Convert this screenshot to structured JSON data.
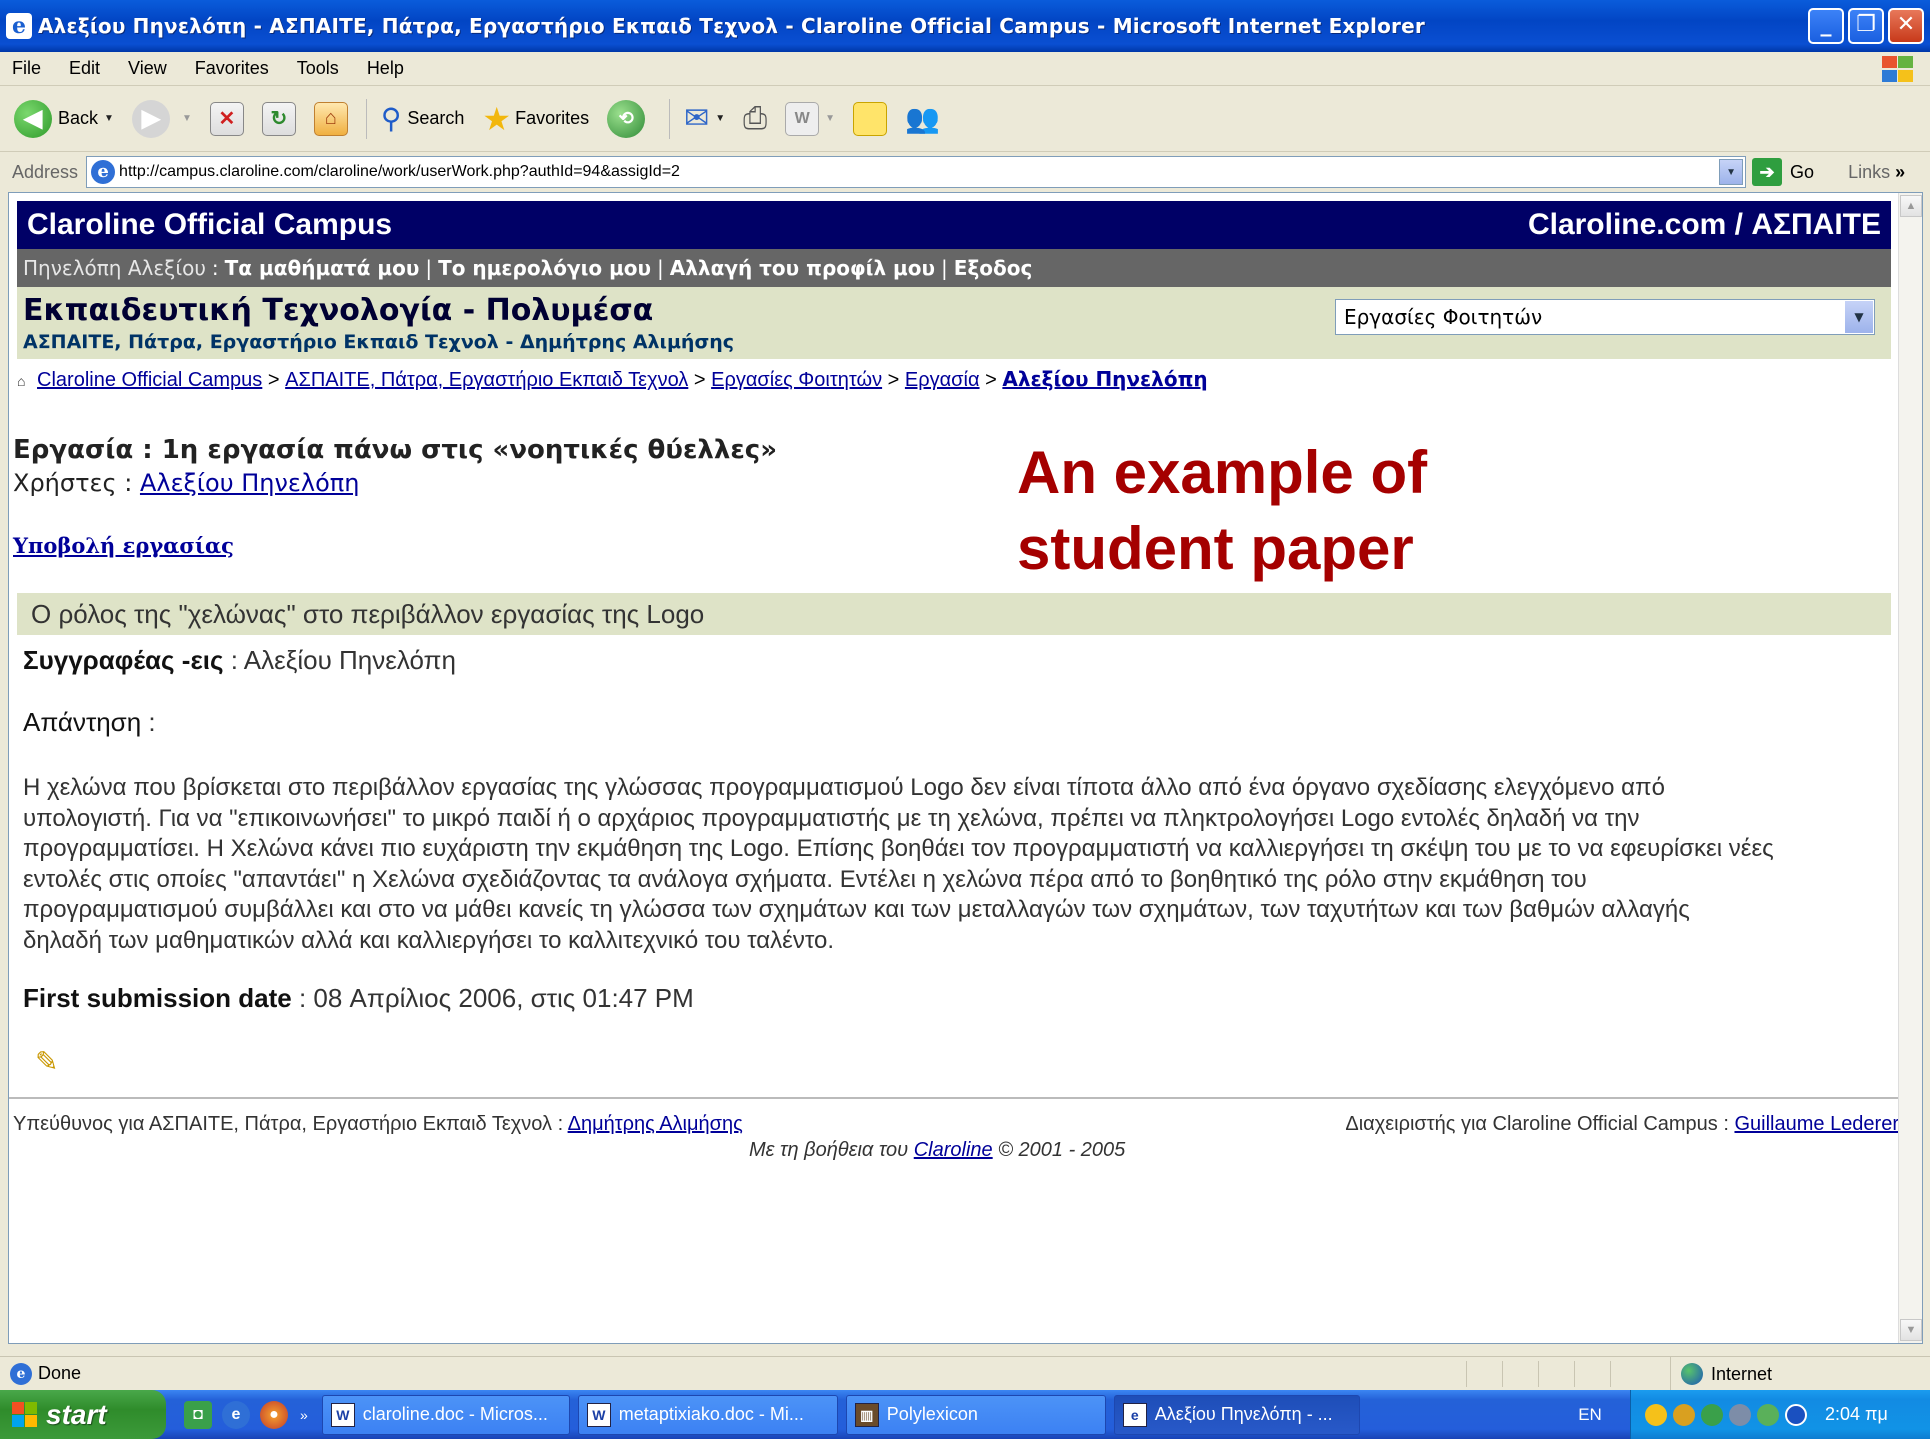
{
  "window": {
    "title": "Αλεξίου Πηνελόπη - ΑΣΠΑΙΤΕ, Πάτρα, Εργαστήριο Εκπαιδ Τεχνολ - Claroline Official Campus - Microsoft Internet Explorer",
    "buttons": {
      "minimize": "_",
      "maximize": "❐",
      "close": "✕"
    }
  },
  "menu": [
    "File",
    "Edit",
    "View",
    "Favorites",
    "Tools",
    "Help"
  ],
  "toolbar": {
    "back": "Back",
    "search": "Search",
    "favorites": "Favorites"
  },
  "address": {
    "label": "Address",
    "url": "http://campus.claroline.com/claroline/work/userWork.php?authId=94&assigId=2",
    "go": "Go",
    "links": "Links"
  },
  "page": {
    "campus_name": "Claroline Official Campus",
    "campus_right": "Claroline.com / ΑΣΠΑΙΤΕ",
    "user_name": "Πηνελόπη Αλεξίου",
    "user_links": [
      "Τα μαθήματά μου",
      "Το ημερολόγιο μου",
      "Αλλαγή του προφίλ μου",
      "Εξοδος"
    ],
    "course_title": "Εκπαιδευτική Τεχνολογία - Πολυμέσα",
    "course_subtitle": "ΑΣΠΑΙΤΕ, Πάτρα, Εργαστήριο Εκπαιδ Τεχνολ - Δημήτρης Αλιμήσης",
    "tool_select": "Εργασίες Φοιτητών",
    "breadcrumb": [
      "Claroline Official Campus",
      "ΑΣΠΑΙΤΕ, Πάτρα, Εργαστήριο Εκπαιδ Τεχνολ",
      "Εργασίες Φοιτητών",
      "Εργασία",
      "Αλεξίου Πηνελόπη"
    ],
    "assignment_label": "Εργασία",
    "assignment_title": "1η εργασία πάνω στις «νοητικές θύελλες»",
    "users_label": "Χρήστες",
    "users_value": "Αλεξίου Πηνελόπη",
    "submit_link": "Υποβολή εργασίας",
    "paper_title": "Ο ρόλος της \"χελώνας\" στο περιβάλλον εργασίας της Logo",
    "authors_label": "Συγγραφέας -εις",
    "authors_value": "Αλεξίου Πηνελόπη",
    "answer_label": "Απάντηση",
    "answer_lines": [
      "Η χελώνα που βρίσκεται στο περιβάλλον εργασίας της γλώσσας προγραμματισμού Logo δεν είναι τίποτα άλλο από ένα όργανο σχεδίασης ελεγχόμενο από",
      "υπολογιστή. Για να \"επικοινωνήσει\" το μικρό παιδί ή ο αρχάριος προγραμματιστής με τη χελώνα, πρέπει να πληκτρολογήσει Logo εντολές δηλαδή να την",
      "προγραμματίσει. Η Χελώνα κάνει πιο ευχάριστη την εκμάθηση της Logo. Επίσης βοηθάει τον προγραμματιστή να καλλιεργήσει τη σκέψη του με το να εφευρίσκει νέες",
      "εντολές στις οποίες \"απαντάει\" η Χελώνα σχεδιάζοντας τα ανάλογα σχήματα. Εντέλει η χελώνα πέρα από το βοηθητικό της ρόλο στην εκμάθηση του",
      "προγραμματισμού συμβάλλει και στο να μάθει κανείς τη γλώσσα των σχημάτων και των μεταλλαγών των σχημάτων, των ταχυτήτων και των βαθμών αλλαγής",
      "δηλαδή των μαθηματικών αλλά και καλλιεργήσει το καλλιτεχνικό του ταλέντο."
    ],
    "first_submission_label": "First submission date",
    "first_submission_value": "08 Απρίλιος 2006, στις 01:47 PM",
    "footer_left_prefix": "Υπεύθυνος για ΑΣΠΑΙΤΕ, Πάτρα, Εργαστήριο Εκπαιδ Τεχνολ :",
    "footer_left_link": "Δημήτρης Αλιμήσης",
    "footer_right_prefix": "Διαχειριστής για Claroline Official Campus :",
    "footer_right_link": "Guillaume Lederer",
    "footer_center_prefix": "Με τη βοήθεια του",
    "footer_center_link": "Claroline",
    "footer_center_suffix": "© 2001 - 2005"
  },
  "annotation": {
    "line1": "An example of",
    "line2": "student paper"
  },
  "status": {
    "text": "Done",
    "zone": "Internet"
  },
  "taskbar": {
    "start": "start",
    "tasks": [
      "claroline.doc - Micros...",
      "metaptixiako.doc - Mi...",
      "Polylexicon",
      "Αλεξίου Πηνελόπη - ..."
    ],
    "language": "EN",
    "clock": "2:04 πμ"
  }
}
